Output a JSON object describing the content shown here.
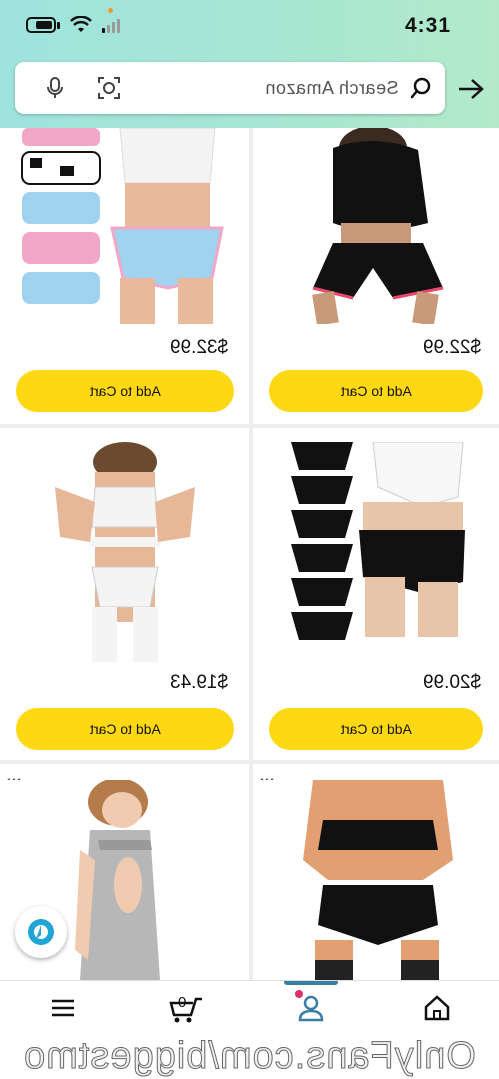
{
  "status_bar": {
    "time": "4:31"
  },
  "search": {
    "placeholder": "Search Amazon"
  },
  "products": [
    {
      "price": "$22.99",
      "button": "Add to Cart"
    },
    {
      "price": "$32.99",
      "button": "Add to Cart"
    },
    {
      "price": "$20.99",
      "button": "Add to Cart"
    },
    {
      "price": "$19.43",
      "button": "Add to Cart"
    },
    {
      "price": "",
      "button": ""
    },
    {
      "price": "",
      "button": ""
    }
  ],
  "more_options": "…",
  "bottom_nav": {
    "cart_count": "0"
  },
  "watermark": "OnlyFans.com/biggestmo",
  "colors": {
    "accent": "#ffd814",
    "header_start": "#9ee3dd",
    "header_end": "#b2eac9",
    "nav_active": "#3a7ea6"
  }
}
